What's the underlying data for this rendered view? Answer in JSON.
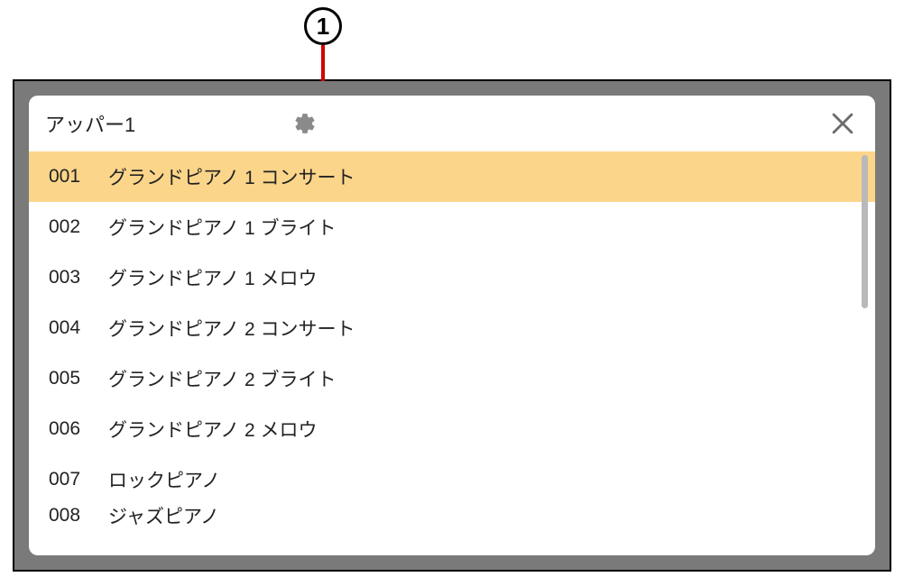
{
  "callout": {
    "label": "1"
  },
  "dialog": {
    "title": "アッパー1",
    "colors": {
      "selected_bg": "#fbd58a",
      "frame_bg": "#7a7a7a"
    },
    "items": [
      {
        "num": "001",
        "name": "グランドピアノ 1 コンサート",
        "selected": true
      },
      {
        "num": "002",
        "name": "グランドピアノ 1 ブライト",
        "selected": false
      },
      {
        "num": "003",
        "name": "グランドピアノ 1 メロウ",
        "selected": false
      },
      {
        "num": "004",
        "name": "グランドピアノ 2 コンサート",
        "selected": false
      },
      {
        "num": "005",
        "name": "グランドピアノ 2 ブライト",
        "selected": false
      },
      {
        "num": "006",
        "name": "グランドピアノ 2 メロウ",
        "selected": false
      },
      {
        "num": "007",
        "name": "ロックピアノ",
        "selected": false
      },
      {
        "num": "008",
        "name": "ジャズピアノ",
        "selected": false
      }
    ]
  }
}
